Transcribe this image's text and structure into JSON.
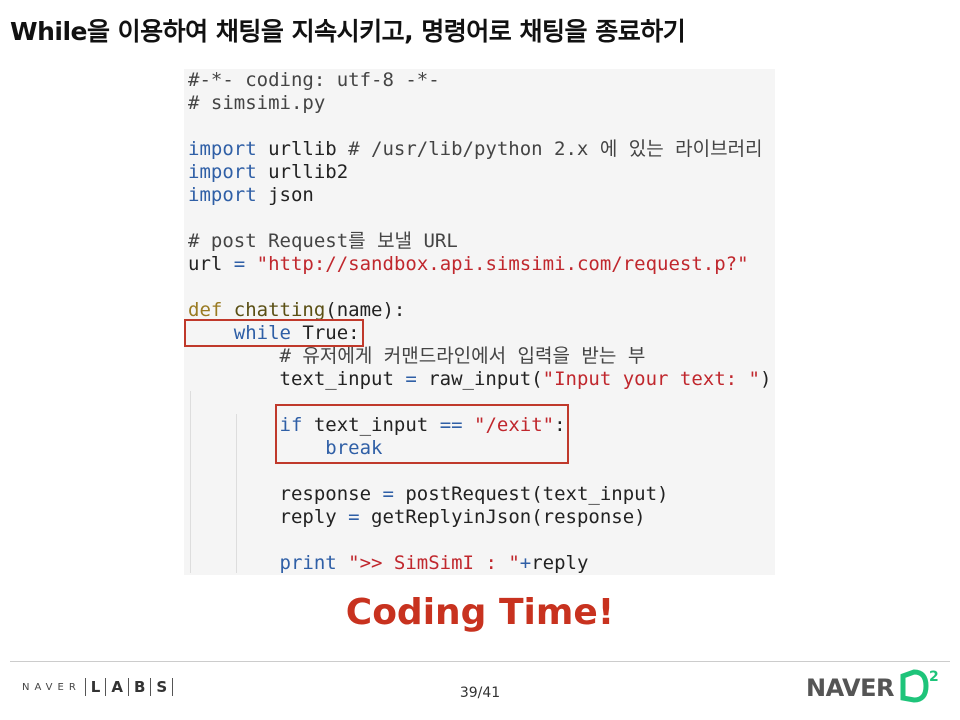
{
  "slide": {
    "title": "While을 이용하여 채팅을 지속시키고, 명령어로 채팅을 종료하기",
    "highlight": "Coding Time!",
    "page": "39/41"
  },
  "code": {
    "lines": [
      [
        [
          "#-*- coding: utf-8 -*-",
          "cm"
        ]
      ],
      [
        [
          "# simsimi.py",
          "cm"
        ]
      ],
      [],
      [
        [
          "import",
          "kw"
        ],
        [
          " urllib ",
          ""
        ],
        [
          "# /usr/lib/python 2.x 에 있는 라이브러리",
          "cm"
        ]
      ],
      [
        [
          "import",
          "kw"
        ],
        [
          " urllib2",
          ""
        ]
      ],
      [
        [
          "import",
          "kw"
        ],
        [
          " json",
          ""
        ]
      ],
      [],
      [
        [
          "# post Request를 보낼 URL",
          "cm"
        ]
      ],
      [
        [
          "url ",
          ""
        ],
        [
          "=",
          "op"
        ],
        [
          " ",
          ""
        ],
        [
          "\"http://sandbox.api.simsimi.com/request.p?\"",
          "str"
        ]
      ],
      [],
      [
        [
          "def",
          "df"
        ],
        [
          " ",
          ""
        ],
        [
          "chatting",
          "fn"
        ],
        [
          "(name):",
          ""
        ]
      ],
      [
        [
          "    ",
          ""
        ],
        [
          "while",
          "kw"
        ],
        [
          " True:",
          ""
        ]
      ],
      [
        [
          "        ",
          ""
        ],
        [
          "# 유저에게 커맨드라인에서 입력을 받는 부",
          "cm"
        ]
      ],
      [
        [
          "        text_input ",
          ""
        ],
        [
          "=",
          "op"
        ],
        [
          " raw_input(",
          ""
        ],
        [
          "\"Input your text: \"",
          "str"
        ],
        [
          ")",
          ""
        ]
      ],
      [],
      [
        [
          "        ",
          ""
        ],
        [
          "if",
          "kw"
        ],
        [
          " text_input ",
          ""
        ],
        [
          "==",
          "op"
        ],
        [
          " ",
          ""
        ],
        [
          "\"/exit\"",
          "str"
        ],
        [
          ":",
          ""
        ]
      ],
      [
        [
          "            ",
          ""
        ],
        [
          "break",
          "kw"
        ]
      ],
      [],
      [
        [
          "        response ",
          ""
        ],
        [
          "=",
          "op"
        ],
        [
          " postRequest(text_input)",
          ""
        ]
      ],
      [
        [
          "        reply ",
          ""
        ],
        [
          "=",
          "op"
        ],
        [
          " getReplyinJson(response)",
          ""
        ]
      ],
      [],
      [
        [
          "        ",
          ""
        ],
        [
          "print",
          "kw"
        ],
        [
          " ",
          ""
        ],
        [
          "\">> SimSimI : \"",
          "str"
        ],
        [
          "+",
          "op"
        ],
        [
          "reply",
          ""
        ]
      ]
    ]
  },
  "branding": {
    "left_logo": "NAVER",
    "left_logo_letters": [
      "L",
      "A",
      "B",
      "S"
    ],
    "right_logo": "NAVER",
    "right_logo_mark": "D2"
  },
  "colors": {
    "highlight_box": "#c0392b",
    "accent_red": "#c8321f",
    "d2_green": "#1ec47a"
  }
}
